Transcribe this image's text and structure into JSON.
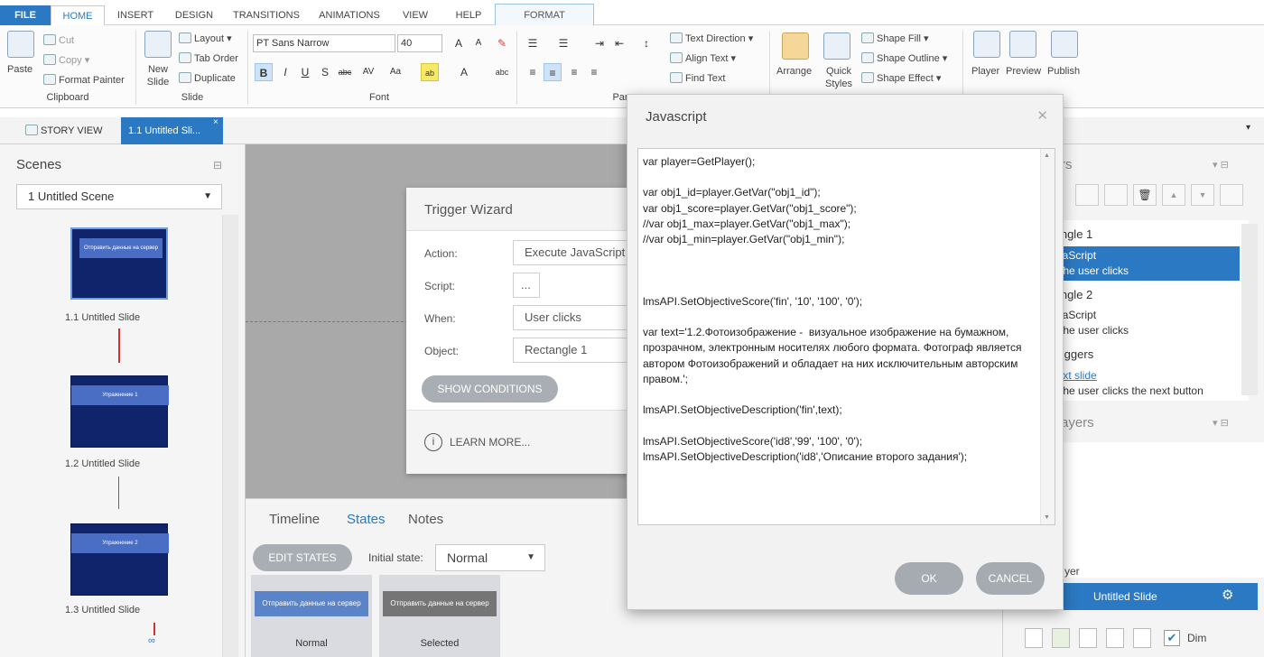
{
  "ribbon_tabs": [
    "FILE",
    "HOME",
    "INSERT",
    "DESIGN",
    "TRANSITIONS",
    "ANIMATIONS",
    "VIEW",
    "HELP",
    "FORMAT"
  ],
  "clipboard": {
    "paste": "Paste",
    "cut": "Cut",
    "copy": "Copy",
    "format_painter": "Format Painter",
    "group": "Clipboard"
  },
  "slide": {
    "new_slide": "New Slide",
    "layout": "Layout",
    "tab_order": "Tab Order",
    "duplicate": "Duplicate",
    "group": "Slide"
  },
  "font": {
    "family": "PT Sans Narrow",
    "size": "40",
    "group": "Font"
  },
  "paragraph": {
    "text_direction": "Text Direction",
    "align_text": "Align Text",
    "find_text": "Find Text",
    "group": "Par"
  },
  "drawing": {
    "arrange": "Arrange",
    "quick_styles": "Quick Styles",
    "shape_fill": "Shape Fill",
    "shape_outline": "Shape Outline",
    "shape_effect": "Shape Effect"
  },
  "publish": {
    "player": "Player",
    "preview": "Preview",
    "publish": "Publish"
  },
  "view_tabs": {
    "story_view": "STORY VIEW",
    "slide_tab": "1.1 Untitled Sli..."
  },
  "scenes": {
    "title": "Scenes",
    "selected_scene": "1 Untitled Scene",
    "slides": [
      {
        "label": "1.1 Untitled Slide",
        "bar_text": "Отправить данные на сервер"
      },
      {
        "label": "1.2 Untitled Slide",
        "bar_text": "Упражнение 1"
      },
      {
        "label": "1.3 Untitled Slide",
        "bar_text": "Упражнение 2"
      }
    ]
  },
  "trigger_wizard": {
    "title": "Trigger Wizard",
    "action_label": "Action:",
    "action_value": "Execute JavaScript",
    "script_label": "Script:",
    "script_value": "...",
    "when_label": "When:",
    "when_value": "User clicks",
    "object_label": "Object:",
    "object_value": "Rectangle 1",
    "show_conditions": "SHOW CONDITIONS",
    "learn_more": "LEARN MORE..."
  },
  "bottom_tabs": {
    "timeline": "Timeline",
    "states": "States",
    "notes": "Notes"
  },
  "states": {
    "edit_states": "EDIT STATES",
    "initial_state_label": "Initial state:",
    "initial_state_value": "Normal",
    "cards": [
      {
        "button_text": "Отправить данные на сервер",
        "name": "Normal",
        "color": "#5b84c8"
      },
      {
        "button_text": "Отправить данные на сервер",
        "name": "Selected",
        "color": "#757575"
      }
    ]
  },
  "triggers_panel": {
    "title_fragment": "rs",
    "items": [
      {
        "text": "tangle 1"
      },
      {
        "text": "avaScript",
        "sub": "n the user clicks",
        "selected": true
      },
      {
        "text": "tangle 2"
      },
      {
        "text": "avaScript",
        "sub": "n the user clicks"
      },
      {
        "text": "Triggers"
      },
      {
        "text": "next slide",
        "sub": "n the user clicks the next button",
        "link": true
      }
    ],
    "layers_title": "ayers",
    "player_fragment": "yer",
    "layer_slide": "Untitled Slide",
    "dim_label": "Dim"
  },
  "javascript_dialog": {
    "title": "Javascript",
    "code": "var player=GetPlayer();\n\nvar obj1_id=player.GetVar(\"obj1_id\");\nvar obj1_score=player.GetVar(\"obj1_score\");\n//var obj1_max=player.GetVar(\"obj1_max\");\n//var obj1_min=player.GetVar(\"obj1_min\");\n\n\n\nlmsAPI.SetObjectiveScore('fin', '10', '100', '0');\n\nvar text='1.2.Фотоизображение -  визуальное изображение на бумажном, прозрачном, электронным носителях любого формата. Фотограф является автором Фотоизображений и обладает на них исключительным авторским правом.';\n\nlmsAPI.SetObjectiveDescription('fin',text);\n\nlmsAPI.SetObjectiveScore('id8','99', '100', '0');\nlmsAPI.SetObjectiveDescription('id8','Описание второго задания');",
    "ok": "OK",
    "cancel": "CANCEL"
  }
}
